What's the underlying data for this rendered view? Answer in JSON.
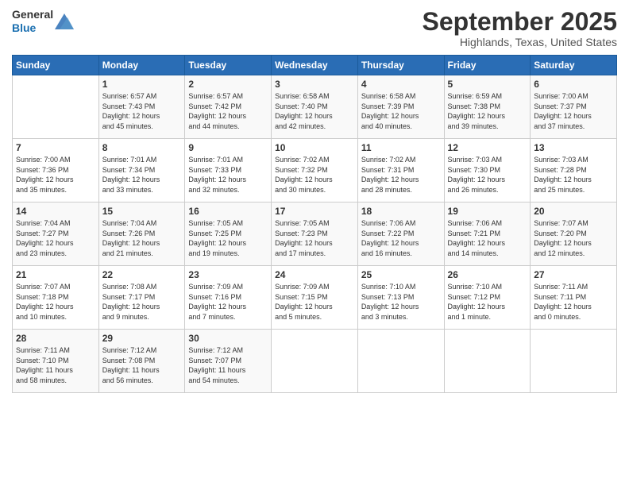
{
  "logo": {
    "general": "General",
    "blue": "Blue"
  },
  "header": {
    "month": "September 2025",
    "location": "Highlands, Texas, United States"
  },
  "days_of_week": [
    "Sunday",
    "Monday",
    "Tuesday",
    "Wednesday",
    "Thursday",
    "Friday",
    "Saturday"
  ],
  "weeks": [
    [
      {
        "day": "",
        "info": ""
      },
      {
        "day": "1",
        "info": "Sunrise: 6:57 AM\nSunset: 7:43 PM\nDaylight: 12 hours\nand 45 minutes."
      },
      {
        "day": "2",
        "info": "Sunrise: 6:57 AM\nSunset: 7:42 PM\nDaylight: 12 hours\nand 44 minutes."
      },
      {
        "day": "3",
        "info": "Sunrise: 6:58 AM\nSunset: 7:40 PM\nDaylight: 12 hours\nand 42 minutes."
      },
      {
        "day": "4",
        "info": "Sunrise: 6:58 AM\nSunset: 7:39 PM\nDaylight: 12 hours\nand 40 minutes."
      },
      {
        "day": "5",
        "info": "Sunrise: 6:59 AM\nSunset: 7:38 PM\nDaylight: 12 hours\nand 39 minutes."
      },
      {
        "day": "6",
        "info": "Sunrise: 7:00 AM\nSunset: 7:37 PM\nDaylight: 12 hours\nand 37 minutes."
      }
    ],
    [
      {
        "day": "7",
        "info": "Sunrise: 7:00 AM\nSunset: 7:36 PM\nDaylight: 12 hours\nand 35 minutes."
      },
      {
        "day": "8",
        "info": "Sunrise: 7:01 AM\nSunset: 7:34 PM\nDaylight: 12 hours\nand 33 minutes."
      },
      {
        "day": "9",
        "info": "Sunrise: 7:01 AM\nSunset: 7:33 PM\nDaylight: 12 hours\nand 32 minutes."
      },
      {
        "day": "10",
        "info": "Sunrise: 7:02 AM\nSunset: 7:32 PM\nDaylight: 12 hours\nand 30 minutes."
      },
      {
        "day": "11",
        "info": "Sunrise: 7:02 AM\nSunset: 7:31 PM\nDaylight: 12 hours\nand 28 minutes."
      },
      {
        "day": "12",
        "info": "Sunrise: 7:03 AM\nSunset: 7:30 PM\nDaylight: 12 hours\nand 26 minutes."
      },
      {
        "day": "13",
        "info": "Sunrise: 7:03 AM\nSunset: 7:28 PM\nDaylight: 12 hours\nand 25 minutes."
      }
    ],
    [
      {
        "day": "14",
        "info": "Sunrise: 7:04 AM\nSunset: 7:27 PM\nDaylight: 12 hours\nand 23 minutes."
      },
      {
        "day": "15",
        "info": "Sunrise: 7:04 AM\nSunset: 7:26 PM\nDaylight: 12 hours\nand 21 minutes."
      },
      {
        "day": "16",
        "info": "Sunrise: 7:05 AM\nSunset: 7:25 PM\nDaylight: 12 hours\nand 19 minutes."
      },
      {
        "day": "17",
        "info": "Sunrise: 7:05 AM\nSunset: 7:23 PM\nDaylight: 12 hours\nand 17 minutes."
      },
      {
        "day": "18",
        "info": "Sunrise: 7:06 AM\nSunset: 7:22 PM\nDaylight: 12 hours\nand 16 minutes."
      },
      {
        "day": "19",
        "info": "Sunrise: 7:06 AM\nSunset: 7:21 PM\nDaylight: 12 hours\nand 14 minutes."
      },
      {
        "day": "20",
        "info": "Sunrise: 7:07 AM\nSunset: 7:20 PM\nDaylight: 12 hours\nand 12 minutes."
      }
    ],
    [
      {
        "day": "21",
        "info": "Sunrise: 7:07 AM\nSunset: 7:18 PM\nDaylight: 12 hours\nand 10 minutes."
      },
      {
        "day": "22",
        "info": "Sunrise: 7:08 AM\nSunset: 7:17 PM\nDaylight: 12 hours\nand 9 minutes."
      },
      {
        "day": "23",
        "info": "Sunrise: 7:09 AM\nSunset: 7:16 PM\nDaylight: 12 hours\nand 7 minutes."
      },
      {
        "day": "24",
        "info": "Sunrise: 7:09 AM\nSunset: 7:15 PM\nDaylight: 12 hours\nand 5 minutes."
      },
      {
        "day": "25",
        "info": "Sunrise: 7:10 AM\nSunset: 7:13 PM\nDaylight: 12 hours\nand 3 minutes."
      },
      {
        "day": "26",
        "info": "Sunrise: 7:10 AM\nSunset: 7:12 PM\nDaylight: 12 hours\nand 1 minute."
      },
      {
        "day": "27",
        "info": "Sunrise: 7:11 AM\nSunset: 7:11 PM\nDaylight: 12 hours\nand 0 minutes."
      }
    ],
    [
      {
        "day": "28",
        "info": "Sunrise: 7:11 AM\nSunset: 7:10 PM\nDaylight: 11 hours\nand 58 minutes."
      },
      {
        "day": "29",
        "info": "Sunrise: 7:12 AM\nSunset: 7:08 PM\nDaylight: 11 hours\nand 56 minutes."
      },
      {
        "day": "30",
        "info": "Sunrise: 7:12 AM\nSunset: 7:07 PM\nDaylight: 11 hours\nand 54 minutes."
      },
      {
        "day": "",
        "info": ""
      },
      {
        "day": "",
        "info": ""
      },
      {
        "day": "",
        "info": ""
      },
      {
        "day": "",
        "info": ""
      }
    ]
  ]
}
